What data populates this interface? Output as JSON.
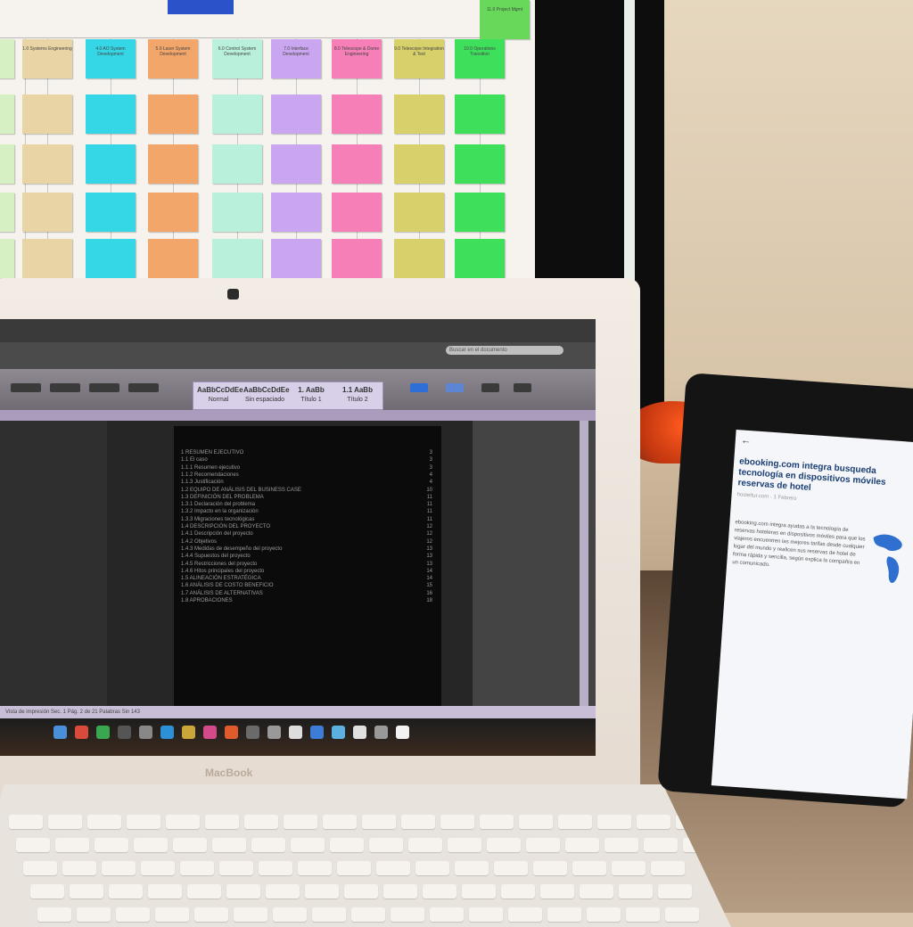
{
  "scene": {
    "laptop_brand": "MacBook"
  },
  "monitor": {
    "notes": [
      {
        "text": "11.0 Project Mgmt",
        "color": "#67d85a"
      },
      {
        "text": "1.0 Systems Engineering",
        "color": "#e8d4a4"
      },
      {
        "text": "4.0 AO System Development",
        "color": "#35d7e6"
      },
      {
        "text": "5.0 Laser System Development",
        "color": "#f2a66a"
      },
      {
        "text": "6.0 Control System Development",
        "color": "#b9f0dc"
      },
      {
        "text": "7.0 Interface Development",
        "color": "#c9a6ef"
      },
      {
        "text": "8.0 Telescope & Dome Engineering",
        "color": "#f57fb6"
      },
      {
        "text": "9.0 Telescope Integration & Test",
        "color": "#d8d06b"
      },
      {
        "text": "10.0 Operations Transition",
        "color": "#3ee05b"
      }
    ]
  },
  "word_doc": {
    "search_placeholder": "Buscar en el documento",
    "styles": [
      {
        "preview": "AaBbCcDdEe",
        "name": "Normal"
      },
      {
        "preview": "AaBbCcDdEe",
        "name": "Sin espaciado"
      },
      {
        "preview": "1. AaBb",
        "name": "Título 1"
      },
      {
        "preview": "1.1 AaBb",
        "name": "Título 2"
      }
    ],
    "toc": [
      {
        "text": "1    RESUMEN EJECUTIVO",
        "page": "3"
      },
      {
        "text": "1.1    El caso",
        "page": "3"
      },
      {
        "text": "1.1.1    Resumen ejecutivo",
        "page": "3"
      },
      {
        "text": "1.1.2    Recomendaciones",
        "page": "4"
      },
      {
        "text": "1.1.3    Justificación",
        "page": "4"
      },
      {
        "text": "1.2    EQUIPO DE ANÁLISIS DEL BUSINESS CASE",
        "page": "10"
      },
      {
        "text": "1.3    DEFINICIÓN DEL PROBLEMA",
        "page": "11"
      },
      {
        "text": "1.3.1    Declaración del problema",
        "page": "11"
      },
      {
        "text": "1.3.2    Impacto en la organización",
        "page": "11"
      },
      {
        "text": "1.3.3    Migraciones tecnológicas",
        "page": "11"
      },
      {
        "text": "1.4    DESCRIPCIÓN DEL PROYECTO",
        "page": "12"
      },
      {
        "text": "1.4.1    Descripción del proyecto",
        "page": "12"
      },
      {
        "text": "1.4.2    Objetivos",
        "page": "12"
      },
      {
        "text": "1.4.3    Medidas de desempeño del proyecto",
        "page": "13"
      },
      {
        "text": "1.4.4    Supuestos del proyecto",
        "page": "13"
      },
      {
        "text": "1.4.5    Restricciones del proyecto",
        "page": "13"
      },
      {
        "text": "1.4.6    Hitos principales del proyecto",
        "page": "14"
      },
      {
        "text": "1.5    ALINEACIÓN ESTRATÉGICA",
        "page": "14"
      },
      {
        "text": "1.6    ANÁLISIS DE COSTO BENEFICIO",
        "page": "15"
      },
      {
        "text": "1.7    ANÁLISIS DE ALTERNATIVAS",
        "page": "16"
      },
      {
        "text": "1.8    APROBACIONES",
        "page": "18"
      }
    ],
    "statusbar": "Vista de impresión   Sec. 1   Pág. 2 de 21   Palabras   Sin 143"
  },
  "tablet": {
    "title": "ebooking.com integra busqueda tecnología en dispositivos móviles reservas de hotel",
    "meta": "hosteltur.com · 1 Febrero",
    "body": "ebooking.com integra ayudas a la tecnología de reservas hoteleras en dispositivos móviles para que los viajeros encuentren las mejores tarifas desde cualquier lugar del mundo y realicen sus reservas de hotel de forma rápida y sencilla, según explica la compañía en un comunicado."
  }
}
